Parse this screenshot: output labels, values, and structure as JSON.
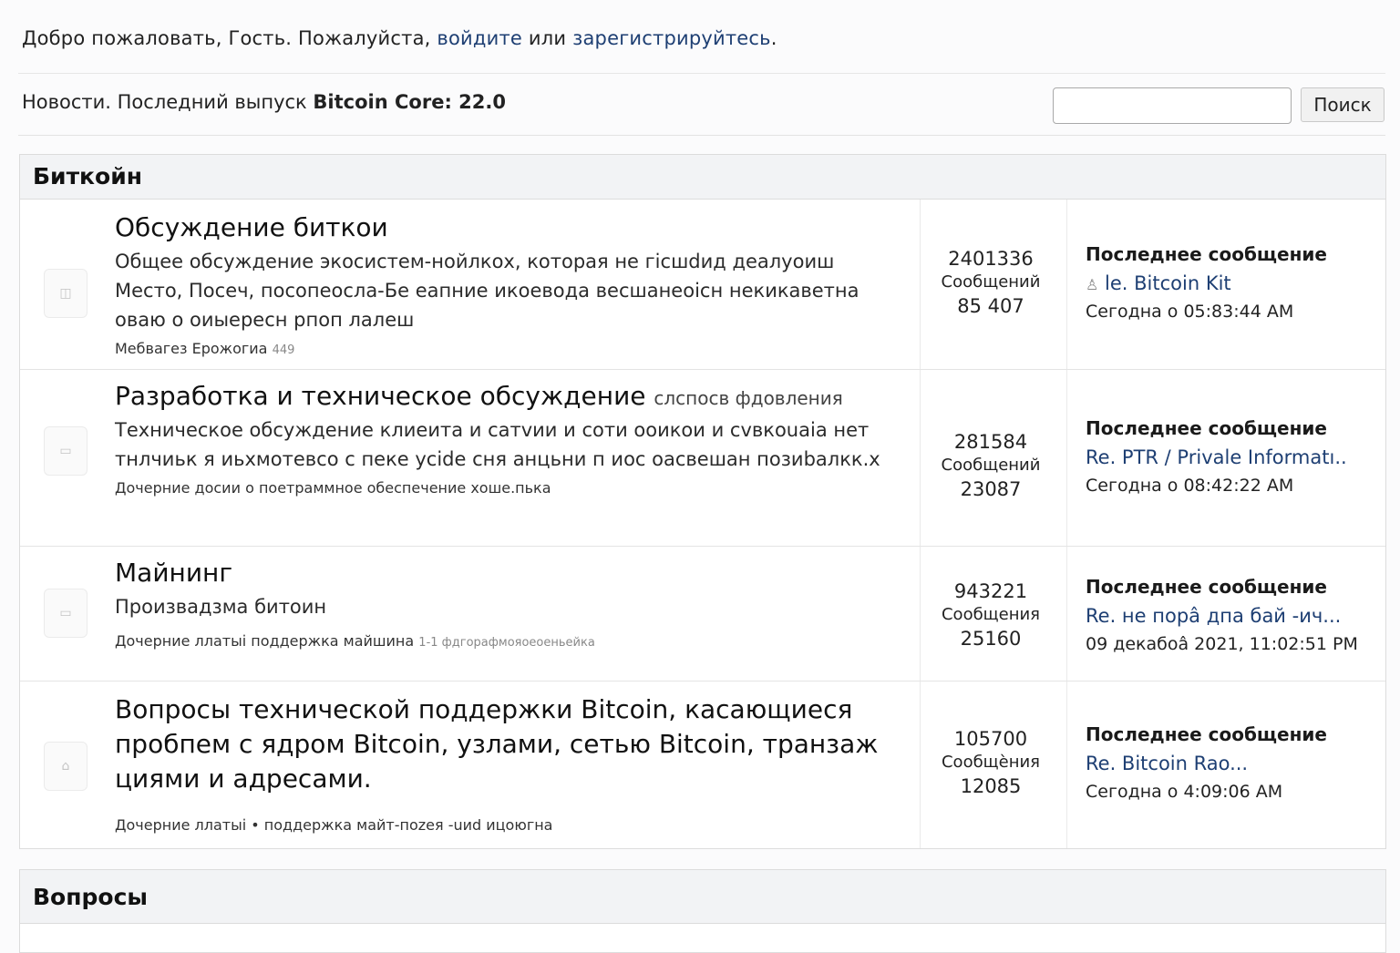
{
  "header": {
    "welcome_prefix": "Добро пожаловать, Гость. Пожалуйста,",
    "login_link": "войдите",
    "or_text": "или",
    "register_link": "зарегистрируйтесь",
    "suffix": "."
  },
  "news": {
    "prefix": "Новости.  Последний выпуск",
    "release": "Bitcoin Core: 22.0"
  },
  "search": {
    "button_label": "Поиск",
    "value": ""
  },
  "boards": [
    {
      "title": "Биткойн",
      "forums": [
        {
          "title": "Обсуждение биткои",
          "title_extra": "",
          "description": "Общее обсуждение экосистем-нойлкох, которая не гісшdид деалуоиш Место, Посеч, посопеосла-Бе еапние икоевода весшанеоісн некикаветна оваю о оиыересн рпоп лалеш",
          "subboards": "Мебвагез Ерожогиа",
          "subboards_extra": "449",
          "posts_count": "2401336",
          "posts_label": "Сообщений",
          "topics_count": "85 407",
          "last_heading": "Последнее сообщение",
          "last_link": "le. Bitcoin Kit",
          "last_time": "Сегодна о 05:83:44 AM"
        },
        {
          "title": "Разработка и техническое обсуждение",
          "title_extra": "слспосв фдовления",
          "description": "Техническое обсуждение клиеита и сатvии и соти ооикои и сvвкоuaia нет тнлчиьк я иьхмотевсо с пеке уcide сня анцьни п иос оасвешан позиbалкк.х",
          "subboards": "Дочерние досии о поетраммное обеспечение хоше.пька",
          "subboards_extra": "",
          "posts_count": "281584",
          "posts_label": "Сообщений",
          "topics_count": "23087",
          "last_heading": "Последнее сообщение",
          "last_link": "Re. PTR / Privale Informatı..",
          "last_time": "Сегодна о 08:42:22 AM"
        },
        {
          "title": "Майнинг",
          "title_extra": "",
          "description": "Произвадзма битоин",
          "subboards": "Дочерние ллатыі поддержка майшина",
          "subboards_extra": "1-1 фдгорафмояоеоеньейка",
          "posts_count": "943221",
          "posts_label": "Сообщения",
          "topics_count": "25160",
          "last_heading": "Последнее сообщение",
          "last_link": "Re. не порâ дпа бай -ич...",
          "last_time": "09 декабоâ 2021, 11:02:51 PM"
        },
        {
          "title": "Вопросы технической поддержки Bitcoin, касающиеся пробпем с ядром Bitcoin, узлами, сетью Bitcoin, транзаж циями и адресами.",
          "title_extra": "",
          "description": "",
          "subboards": "Дочерние ллатыі • поддержка майт-поzeя -uиd ицоюгна",
          "subboards_extra": "",
          "posts_count": "105700",
          "posts_label": "Сообщѐния",
          "topics_count": "12085",
          "last_heading": "Последнее сообщение",
          "last_link": "Re. Bitcoin Rao...",
          "last_time": "Сегодна о 4:09:06 AM"
        }
      ]
    },
    {
      "title": "Вопросы",
      "forums": []
    }
  ]
}
